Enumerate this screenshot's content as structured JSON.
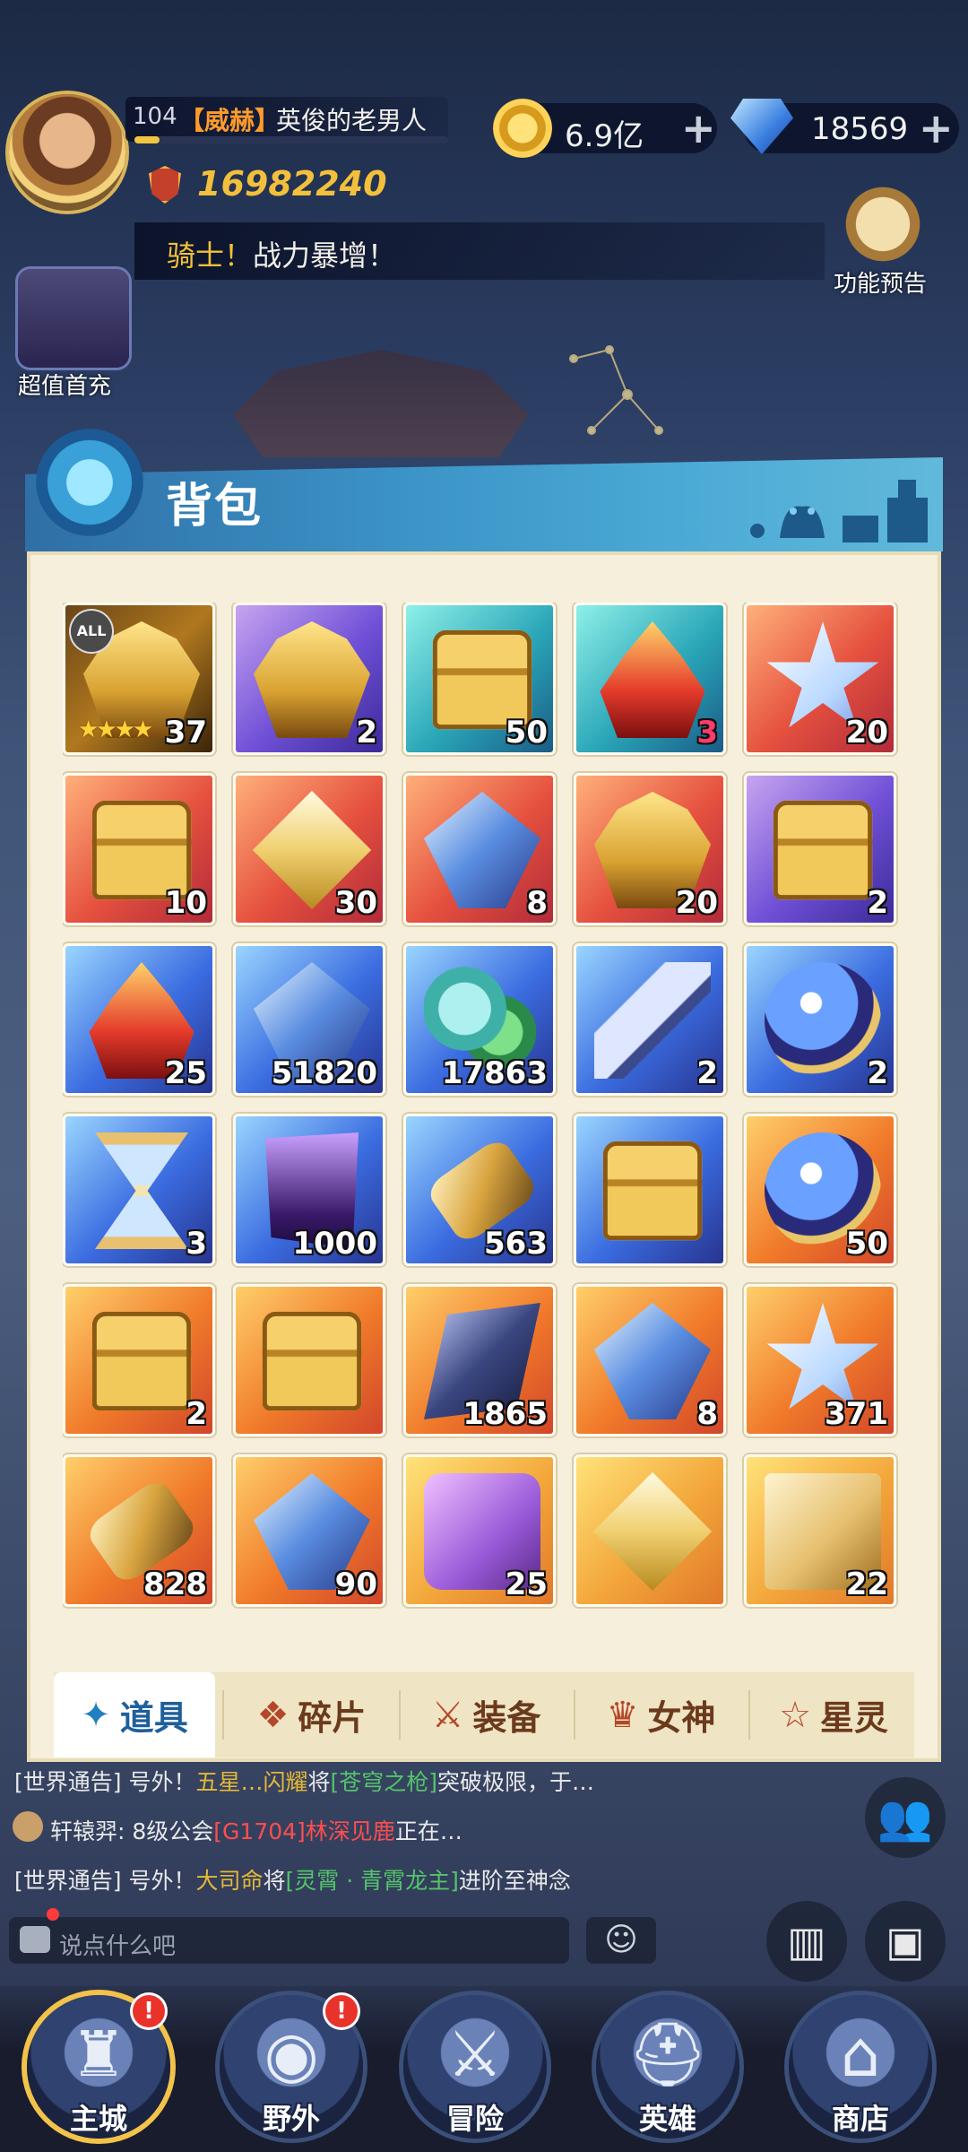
{
  "player": {
    "level": "104",
    "guild_tag": "【威赫】",
    "name": "英俊的老男人",
    "power": "16982240"
  },
  "currency": {
    "gold": "6.9亿",
    "gems": "18569",
    "plus": "+"
  },
  "notice": {
    "text_highlight": "骑士！",
    "text_rest": "战力暴增！"
  },
  "side_buttons": {
    "first_recharge": "超值首充",
    "feature_preview": "功能预告"
  },
  "bag": {
    "title": "背包",
    "items": [
      {
        "count": "37",
        "bg": "gold",
        "art": "mask",
        "stars": "★★★★",
        "badge": "ALL"
      },
      {
        "count": "2",
        "bg": "purple",
        "art": "mask"
      },
      {
        "count": "50",
        "bg": "teal",
        "art": "chest"
      },
      {
        "count": "3",
        "bg": "teal",
        "art": "flame",
        "count_color": "red"
      },
      {
        "count": "20",
        "bg": "red",
        "art": "star"
      },
      {
        "count": "10",
        "bg": "red",
        "art": "chest"
      },
      {
        "count": "30",
        "bg": "red",
        "art": "cube"
      },
      {
        "count": "8",
        "bg": "red",
        "art": "gem"
      },
      {
        "count": "20",
        "bg": "red",
        "art": "mask"
      },
      {
        "count": "2",
        "bg": "purple",
        "art": "chest"
      },
      {
        "count": "25",
        "bg": "blue",
        "art": "flame"
      },
      {
        "count": "51820",
        "bg": "blue",
        "art": "gem"
      },
      {
        "count": "17863",
        "bg": "blue",
        "art": "leaf"
      },
      {
        "count": "2",
        "bg": "blue",
        "art": "feather"
      },
      {
        "count": "2",
        "bg": "blue",
        "art": "orb"
      },
      {
        "count": "3",
        "bg": "blue",
        "art": "hourglass"
      },
      {
        "count": "1000",
        "bg": "blue",
        "art": "scroll"
      },
      {
        "count": "563",
        "bg": "blue",
        "art": "tube"
      },
      {
        "count": "",
        "bg": "blue",
        "art": "chest"
      },
      {
        "count": "50",
        "bg": "orange",
        "art": "orb"
      },
      {
        "count": "2",
        "bg": "orange",
        "art": "chest"
      },
      {
        "count": "",
        "bg": "orange",
        "art": "chest"
      },
      {
        "count": "1865",
        "bg": "orange",
        "art": "dark"
      },
      {
        "count": "8",
        "bg": "orange",
        "art": "gem"
      },
      {
        "count": "371",
        "bg": "orange",
        "art": "star"
      },
      {
        "count": "828",
        "bg": "orange",
        "art": "tube"
      },
      {
        "count": "90",
        "bg": "orange",
        "art": "gem"
      },
      {
        "count": "25",
        "bg": "amber",
        "art": "puzzle"
      },
      {
        "count": "",
        "bg": "amber",
        "art": "cube"
      },
      {
        "count": "22",
        "bg": "amber",
        "art": "book"
      }
    ],
    "tabs": [
      {
        "label": "道具",
        "icon": "✦"
      },
      {
        "label": "碎片",
        "icon": "❖"
      },
      {
        "label": "装备",
        "icon": "⚔"
      },
      {
        "label": "女神",
        "icon": "♛"
      },
      {
        "label": "星灵",
        "icon": "☆"
      }
    ]
  },
  "chat": {
    "line1": {
      "prefix": "[世界通告] 号外！",
      "name": "五星…闪耀",
      "mid": "将",
      "item": "[苍穹之枪]",
      "rest": "突破极限，于…"
    },
    "line2": {
      "name": "轩辕羿:",
      "mid": " 8级公会",
      "guild": "[G1704]林深见鹿",
      "rest": "正在…"
    },
    "line3": {
      "prefix": "[世界通告] 号外！",
      "name": "大司命",
      "mid": "将",
      "item": "[灵霄 · 青霄龙主]",
      "rest": "进阶至神念"
    },
    "placeholder": "说点什么吧",
    "emoji": "☺"
  },
  "nav": [
    {
      "label": "主城",
      "icon": "♜",
      "badge": "!"
    },
    {
      "label": "野外",
      "icon": "◉",
      "badge": "!"
    },
    {
      "label": "冒险",
      "icon": "⚔",
      "badge": ""
    },
    {
      "label": "英雄",
      "icon": "⛑",
      "badge": ""
    },
    {
      "label": "商店",
      "icon": "⌂",
      "badge": ""
    }
  ],
  "colors": {
    "accent_blue": "#3b92c6",
    "gold_text": "#f3c03c",
    "panel_bg": "#f5efdb"
  }
}
